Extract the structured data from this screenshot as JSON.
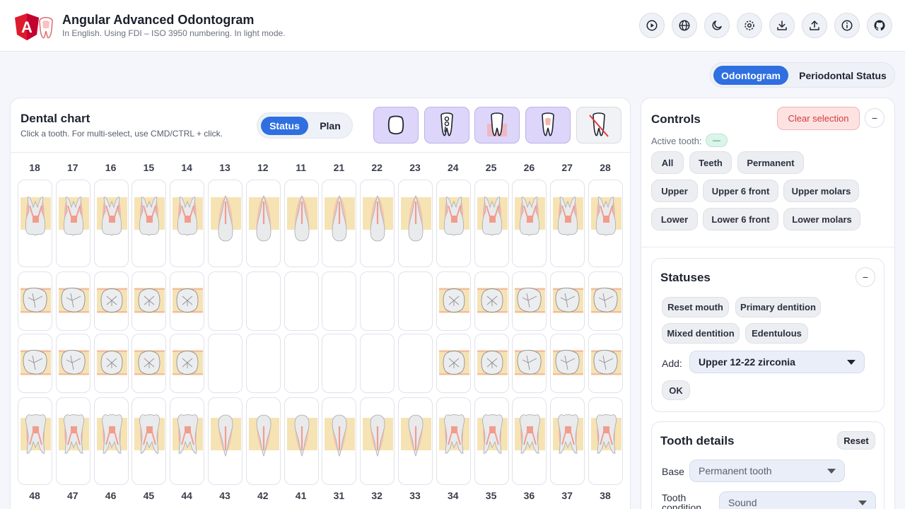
{
  "header": {
    "title": "Angular Advanced Odontogram",
    "subtitle": "In English. Using FDI – ISO 3950 numbering. In light mode.",
    "logo_text": "A",
    "icons": [
      "play-icon",
      "globe-icon",
      "moon-icon",
      "gear-icon",
      "download-icon",
      "upload-icon",
      "info-icon",
      "github-icon"
    ]
  },
  "view_tabs": [
    "Odontogram",
    "Periodontal Status"
  ],
  "chart": {
    "title": "Dental chart",
    "hint": "Click a tooth. For multi-select, use CMD/CTRL + click.",
    "mode_tabs": [
      "Status",
      "Plan"
    ],
    "tools": [
      "surface-outline-icon",
      "root-canal-tooth-icon",
      "gum-tooth-icon",
      "crown-tooth-icon",
      "missing-tooth-icon"
    ],
    "upper_numbers": [
      "18",
      "17",
      "16",
      "15",
      "14",
      "13",
      "12",
      "11",
      "21",
      "22",
      "23",
      "24",
      "25",
      "26",
      "27",
      "28"
    ],
    "lower_numbers": [
      "48",
      "47",
      "46",
      "45",
      "44",
      "43",
      "42",
      "41",
      "31",
      "32",
      "33",
      "34",
      "35",
      "36",
      "37",
      "38"
    ]
  },
  "controls": {
    "title": "Controls",
    "clear_label": "Clear selection",
    "collapse_label": "−",
    "active_label": "Active tooth:",
    "active_value": "—",
    "chips": [
      [
        "All",
        "Teeth",
        "Permanent"
      ],
      [
        "Upper",
        "Upper 6 front",
        "Upper molars"
      ],
      [
        "Lower",
        "Lower 6 front",
        "Lower molars"
      ]
    ]
  },
  "statuses": {
    "title": "Statuses",
    "collapse_label": "−",
    "chips": [
      [
        "Reset mouth",
        "Primary dentition"
      ],
      [
        "Mixed dentition",
        "Edentulous"
      ]
    ],
    "add_label": "Add:",
    "add_value": "Upper 12-22 zirconia",
    "ok_label": "OK"
  },
  "tooth_details": {
    "title": "Tooth details",
    "reset_label": "Reset",
    "base_label": "Base",
    "base_value": "Permanent tooth",
    "condition_label": "Tooth condition",
    "condition_value": "Sound"
  },
  "colors": {
    "accent": "#2f6fe0",
    "tool_bg": "#ddd6fa",
    "gum": "#f6e3b4",
    "pulp": "#f2a0a0",
    "danger": "#d43a3a"
  }
}
